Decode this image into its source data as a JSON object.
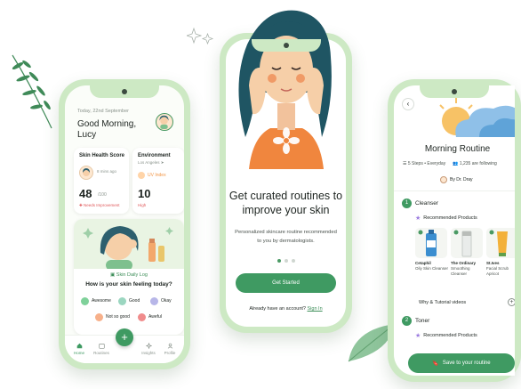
{
  "left_phone": {
    "date": "Today, 22nd September",
    "greeting": "Good Morning,",
    "user_name": "Lucy",
    "skin_score": {
      "title": "Skin Health Score",
      "time_ago": "8 mins ago",
      "score": "48",
      "out_of": "/100",
      "status": "Needs Improvement"
    },
    "environment": {
      "title": "Environment",
      "location": "Los Angeles",
      "uv_label": "UV Index",
      "uv_value": "10",
      "uv_level": "High"
    },
    "daily_log": {
      "label": "Skin Daily Log",
      "question": "How is your skin feeling today?",
      "moods": [
        {
          "label": "Awesome",
          "color": "#7fd19a"
        },
        {
          "label": "Good",
          "color": "#9bd6c0"
        },
        {
          "label": "Okay",
          "color": "#b7b6e8"
        },
        {
          "label": "Not so good",
          "color": "#f7b08a"
        },
        {
          "label": "Aweful",
          "color": "#f08c8c"
        }
      ]
    },
    "nav": [
      {
        "label": "Home",
        "icon": "home-icon"
      },
      {
        "label": "Routines",
        "icon": "calendar-icon"
      },
      {
        "label": "Insights",
        "icon": "sparkle-icon"
      },
      {
        "label": "Profile",
        "icon": "person-icon"
      }
    ]
  },
  "middle_phone": {
    "headline": "Get curated routines to improve your skin",
    "subtext": "Personalized skincare routine recommended to you by dermatologists.",
    "cta": "Get Started",
    "account_prompt": "Already have an account?",
    "sign_in": "Sign In",
    "page_count": 3,
    "active_page": 0
  },
  "right_phone": {
    "title": "Morning Routine",
    "steps_text": "5 Steps • Everyday",
    "following_text": "1,235 are following",
    "author": "By Dr. Dray",
    "step1": {
      "num": "1",
      "name": "Cleanser"
    },
    "step2": {
      "num": "2",
      "name": "Toner"
    },
    "recommended_label": "Recommended Products",
    "products": [
      {
        "brand": "Cetaphil",
        "desc": "Oily Skin Cleanser",
        "color": "#3b8ed0"
      },
      {
        "brand": "The Ordinary",
        "desc": "Smoothing Cleanser",
        "color": "#e9ecea"
      },
      {
        "brand": "St.Ives",
        "desc": "Facial Scrub Apricot",
        "color": "#f3b13a"
      }
    ],
    "why_label": "Why & Tutorial videos",
    "save_label": "Save to your routine"
  },
  "colors": {
    "primary_green": "#3f9a62",
    "phone_frame": "#cde9c4",
    "alert_red": "#e0585a",
    "uv_orange": "#f29544"
  }
}
